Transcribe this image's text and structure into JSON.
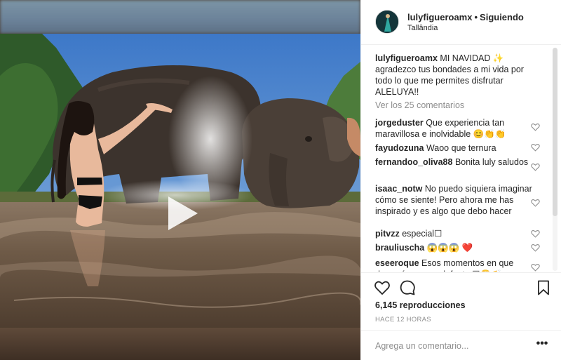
{
  "post": {
    "username": "lulyfigueroamx",
    "follow_status": "Siguiendo",
    "separator": "•",
    "location": "Tallândia"
  },
  "caption": {
    "username": "lulyfigueroamx",
    "text": "MI NAVIDAD ✨ agradezco tus bondades a mi vida por todo lo que me permites disfrutar ALELUYA!!"
  },
  "view_all_comments": "Ver los 25 comentarios",
  "comments": [
    {
      "user": "jorgeduster",
      "text": "Que experiencia tan maravillosa e inolvidable 😊👏👏"
    },
    {
      "user": "fayudozuna",
      "text": "Waoo que ternura"
    },
    {
      "user": "fernandoo_oliva88",
      "text": "Bonita luly saludos"
    },
    {
      "user": "isaac_notw",
      "text": "No puedo siquiera imaginar cómo se siente! Pero ahora me has inspirado y es algo que debo hacer"
    },
    {
      "user": "pitvzz",
      "text": "especial☐"
    },
    {
      "user": "brauliuscha",
      "text": "😱😱😱 ❤️"
    },
    {
      "user": "eseeroque",
      "text": "Esos momentos en que desearía ser un elefante ☐😍👏"
    }
  ],
  "stats": {
    "views": "6,145 reproducciones",
    "time_ago": "HACE 12 HORAS"
  },
  "add_comment": {
    "placeholder": "Agrega un comentario..."
  },
  "more_label": "•••",
  "icons": {
    "play": "play-icon",
    "like": "heart-icon",
    "comment": "comment-bubble-icon",
    "save": "bookmark-icon",
    "more": "more-options-icon",
    "comment_like": "heart-icon"
  },
  "colors": {
    "text": "#262626",
    "muted": "#8e8e8e",
    "border": "#efefef",
    "heart_red": "#ed4956"
  }
}
